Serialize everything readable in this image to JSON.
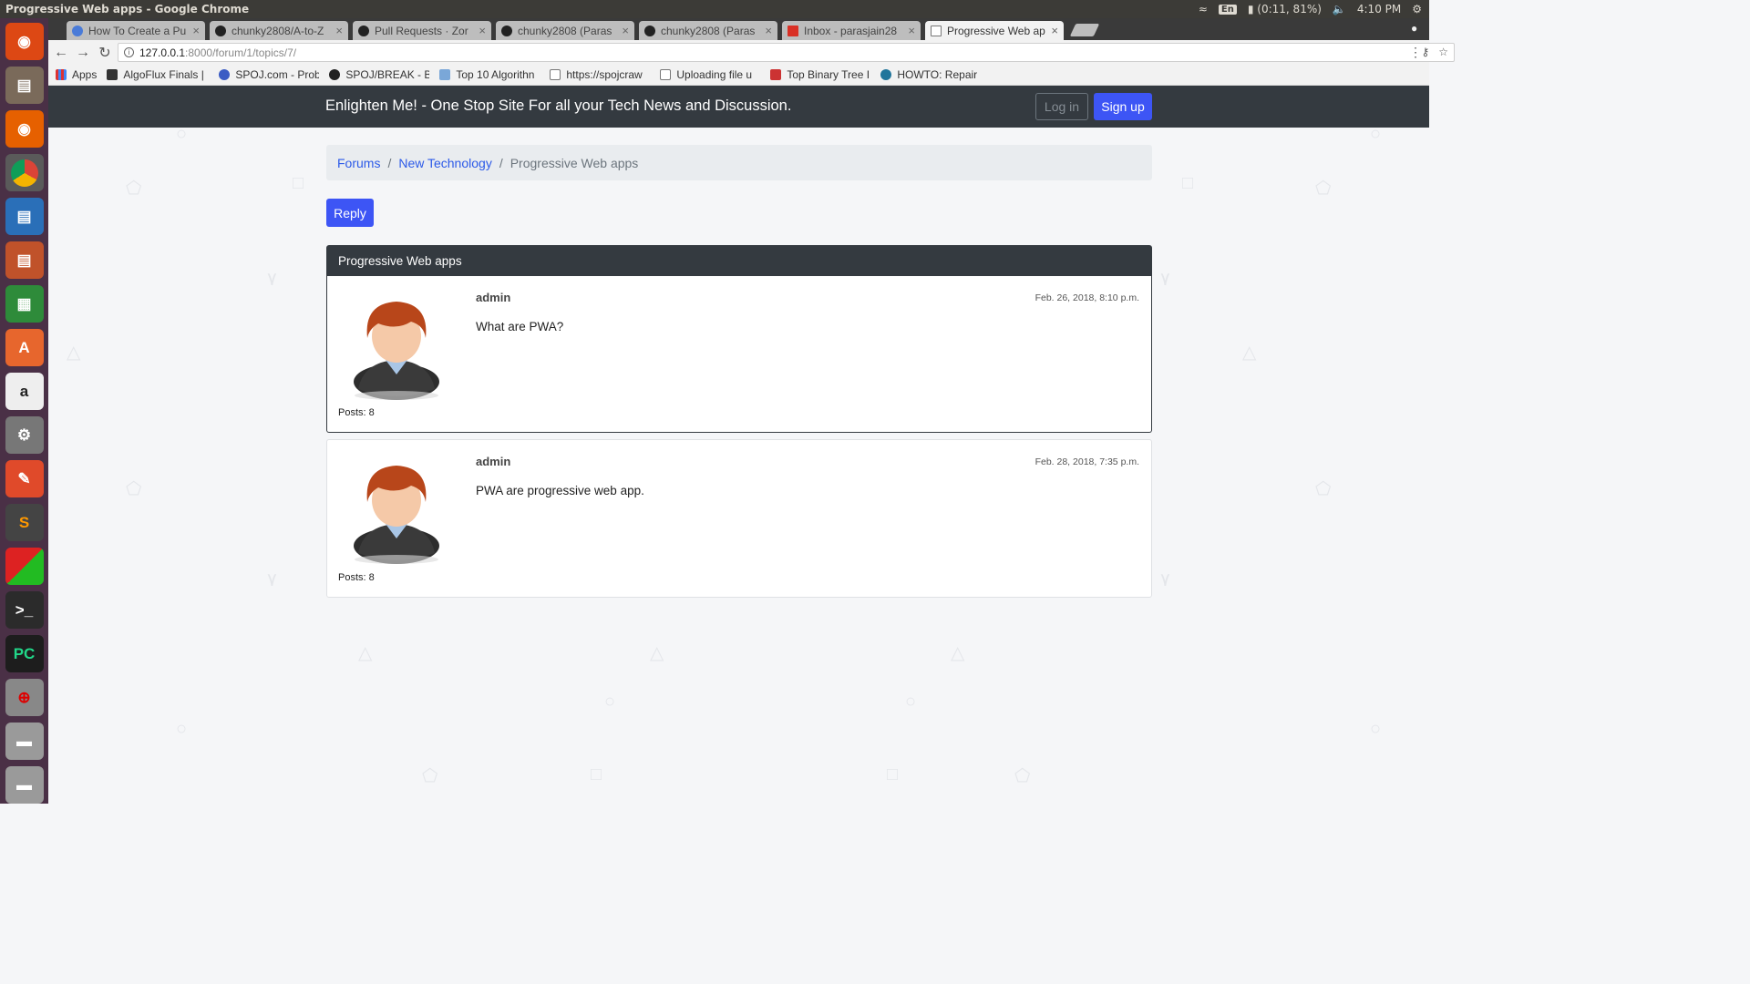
{
  "window": {
    "title": "Progressive Web apps - Google Chrome"
  },
  "system": {
    "keyboard_layout": "En",
    "battery": "(0:11, 81%)",
    "clock": "4:10 PM"
  },
  "tabs": [
    {
      "label": "How To Create a Pu",
      "active": false
    },
    {
      "label": "chunky2808/A-to-Z",
      "active": false
    },
    {
      "label": "Pull Requests · Zor",
      "active": false
    },
    {
      "label": "chunky2808 (Paras",
      "active": false
    },
    {
      "label": "chunky2808 (Paras",
      "active": false
    },
    {
      "label": "Inbox - parasjain28",
      "active": false
    },
    {
      "label": "Progressive Web ap",
      "active": true
    }
  ],
  "address_bar": {
    "host": "127.0.0.1",
    "path": ":8000/forum/1/topics/7/"
  },
  "bookmarks": [
    "Apps",
    "AlgoFlux Finals |",
    "SPOJ.com - Prob",
    "SPOJ/BREAK - B",
    "Top 10 Algorithn",
    "https://spojcraw",
    "Uploading file u",
    "Top Binary Tree I",
    "HOWTO: Repair"
  ],
  "site": {
    "brand": "Enlighten Me! - One Stop Site For all your Tech News and Discussion.",
    "login_label": "Log in",
    "signup_label": "Sign up"
  },
  "breadcrumb": {
    "forums": "Forums",
    "board": "New Technology",
    "current": "Progressive Web apps",
    "separator": "/"
  },
  "reply_label": "Reply",
  "topic": {
    "title": "Progressive Web apps",
    "posts": [
      {
        "author": "admin",
        "date": "Feb. 26, 2018, 8:10 p.m.",
        "message": "What are PWA?",
        "posts_count": "Posts: 8"
      },
      {
        "author": "admin",
        "date": "Feb. 28, 2018, 7:35 p.m.",
        "message": "PWA are progressive web app.",
        "posts_count": "Posts: 8"
      }
    ]
  },
  "colors": {
    "primary": "#3d55f5",
    "navbar": "#343a40",
    "link": "#2c5ae8",
    "launcher": "#4a3046"
  }
}
